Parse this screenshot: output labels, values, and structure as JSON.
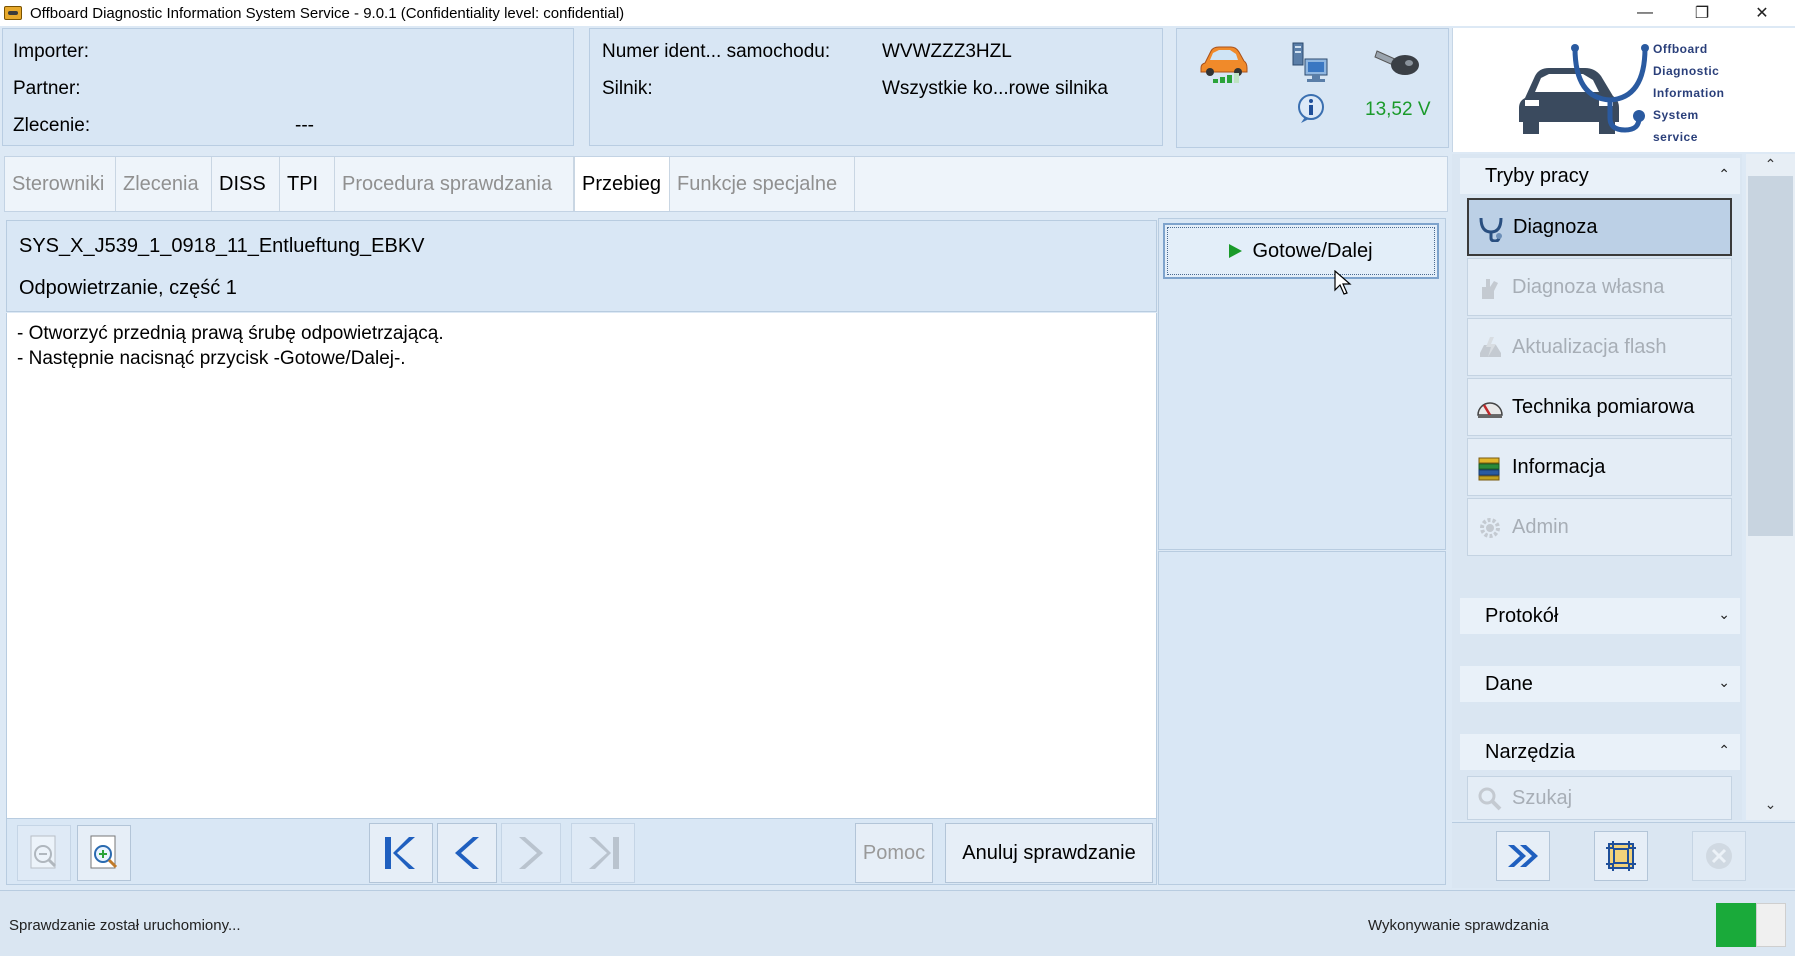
{
  "window": {
    "title": "Offboard Diagnostic Information System Service - 9.0.1 (Confidentiality level: confidential)",
    "minimize_glyph": "—",
    "restore_glyph": "❐",
    "close_glyph": "✕"
  },
  "header": {
    "importer_label": "Importer:",
    "partner_label": "Partner:",
    "order_label": "Zlecenie:",
    "order_value": "---",
    "vin_label": "Numer ident... samochodu:",
    "vin_value": "WVWZZZ3HZL",
    "engine_label": "Silnik:",
    "engine_value": "Wszystkie ko...rowe silnika",
    "voltage": "13,52 V"
  },
  "logo": {
    "lines": [
      "Offboard",
      "Diagnostic",
      "Information",
      "System",
      "service"
    ]
  },
  "tabs": [
    {
      "label": "Sterowniki",
      "state": "disabled"
    },
    {
      "label": "Zlecenia",
      "state": "disabled"
    },
    {
      "label": "DISS",
      "state": "enabled"
    },
    {
      "label": "TPI",
      "state": "enabled"
    },
    {
      "label": "Procedura sprawdzania",
      "state": "disabled"
    },
    {
      "label": "Przebieg",
      "state": "active"
    },
    {
      "label": "Funkcje specjalne",
      "state": "disabled"
    }
  ],
  "test": {
    "id": "SYS_X_J539_1_0918_11_Entlueftung_EBKV",
    "subtitle": "Odpowietrzanie, część 1",
    "instructions": [
      "- Otworzyć przednią prawą śrubę odpowietrzającą.",
      "- Następnie nacisnąć przycisk -Gotowe/Dalej-."
    ],
    "next_button": "Gotowe/Dalej"
  },
  "toolbar": {
    "help_label": "Pomoc",
    "cancel_label": "Anuluj sprawdzanie"
  },
  "sidebar": {
    "modes_title": "Tryby pracy",
    "modes": [
      {
        "label": "Diagnoza",
        "state": "active"
      },
      {
        "label": "Diagnoza własna",
        "state": "disabled"
      },
      {
        "label": "Aktualizacja flash",
        "state": "disabled"
      },
      {
        "label": "Technika pomiarowa",
        "state": "enabled"
      },
      {
        "label": "Informacja",
        "state": "enabled"
      },
      {
        "label": "Admin",
        "state": "disabled"
      }
    ],
    "protocol_title": "Protokół",
    "data_title": "Dane",
    "tools_title": "Narzędzia",
    "search_label": "Szukaj"
  },
  "status": {
    "left": "Sprawdzanie został uruchomiony...",
    "right": "Wykonywanie sprawdzania"
  },
  "colors": {
    "accent_green": "#1a9a2a",
    "nav_blue": "#1f5fbf"
  }
}
